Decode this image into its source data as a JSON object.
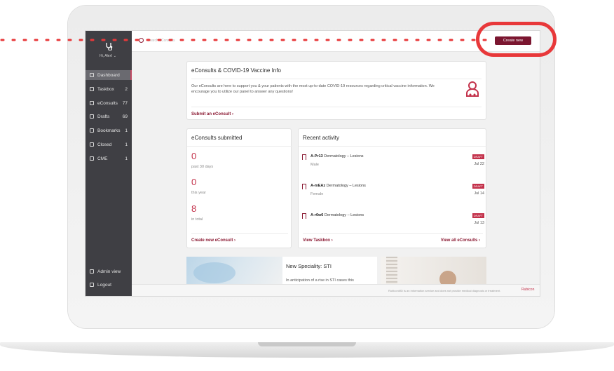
{
  "sidebar": {
    "greeting": "Hi, Alex! ⌄",
    "items": [
      {
        "label": "Dashboard",
        "count": ""
      },
      {
        "label": "Taskbox",
        "count": "2"
      },
      {
        "label": "eConsults",
        "count": "77"
      },
      {
        "label": "Drafts",
        "count": "69"
      },
      {
        "label": "Bookmarks",
        "count": "1"
      },
      {
        "label": "Closed",
        "count": "1"
      },
      {
        "label": "CME",
        "count": "1"
      }
    ],
    "bottom": [
      {
        "label": "Admin view",
        "icon": "admin-icon"
      },
      {
        "label": "Logout",
        "icon": "logout-icon"
      }
    ]
  },
  "topbar": {
    "search_placeholder": "Search eConsults",
    "create_label": "Create new"
  },
  "vaccine": {
    "title": "eConsults & COVID-19 Vaccine Info",
    "body": "Our eConsults are here to support you & your patients with the most up-to-date COVID-19 resources regarding critical vaccine information. We encourage you to utilize our panel to answer any questions!",
    "link": "Submit an eConsult ›"
  },
  "submitted": {
    "title": "eConsults submitted",
    "stats": [
      {
        "value": "0",
        "caption": "past 30 days"
      },
      {
        "value": "0",
        "caption": "this year"
      },
      {
        "value": "8",
        "caption": "in total"
      }
    ],
    "link": "Create new eConsult ›"
  },
  "activity": {
    "title": "Recent activity",
    "rows": [
      {
        "id": "A-Pr13",
        "text": "Dermatology – Lesions",
        "sub": "Male",
        "badge": "DRAFT",
        "date": "Jul 22"
      },
      {
        "id": "A-mEAz",
        "text": "Dermatology – Lesions",
        "sub": "Female",
        "badge": "DRAFT",
        "date": "Jul 14"
      },
      {
        "id": "A-r6w6",
        "text": "Dermatology – Lesions",
        "sub": "",
        "badge": "DRAFT",
        "date": "Jul 13"
      }
    ],
    "link_left": "View Taskbox ›",
    "link_right": "View all eConsults ›"
  },
  "promo": {
    "title": "New Speciality: STI",
    "text": "In anticipation of a rise in STI cases this"
  },
  "footer": {
    "text": "RubiconMD is an information service and does not provide medical diagnosis or treatment.",
    "logo": "Rubicon"
  },
  "colors": {
    "accent": "#8b1a33",
    "sidebar": "#3f3f44",
    "highlight": "#e8383a"
  }
}
